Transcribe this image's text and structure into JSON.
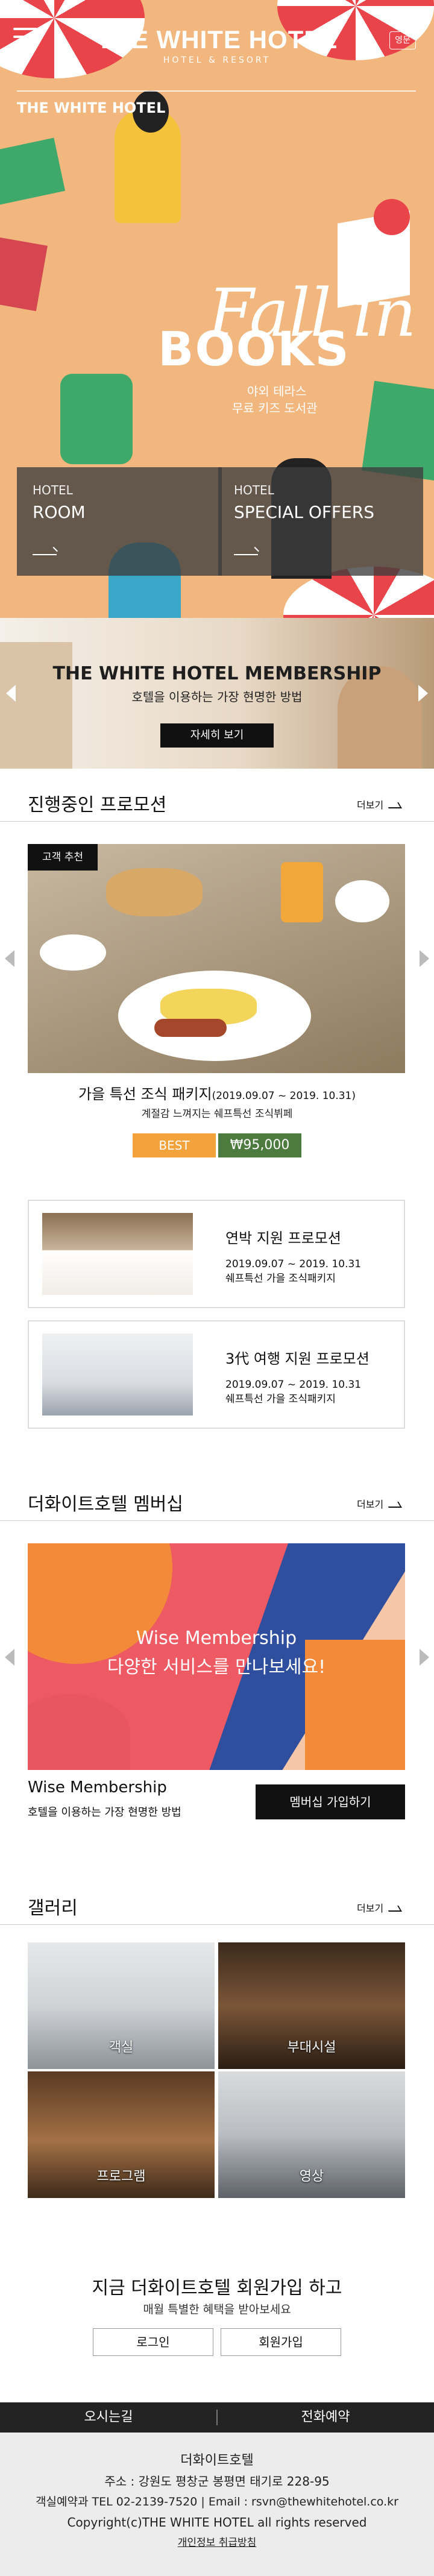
{
  "header": {
    "menu_icon": "hamburger-menu-icon",
    "logo_main": "THE WHITE HOTEL",
    "logo_sub": "HOTEL & RESORT",
    "lang_label": "영문"
  },
  "hero": {
    "tag": "THE WHITE HOTEL",
    "fall": "Fall in",
    "books": "BOOKS",
    "sub1": "야외 테라스",
    "sub2": "무료 키즈 도서관",
    "cards": [
      {
        "small": "HOTEL",
        "title": "ROOM"
      },
      {
        "small": "HOTEL",
        "title": "SPECIAL OFFERS"
      }
    ]
  },
  "membership_banner": {
    "title": "THE WHITE HOTEL MEMBERSHIP",
    "subtitle": "호텔을 이용하는 가장 현명한 방법",
    "button": "자세히 보기"
  },
  "promotions": {
    "title": "진행중인 프로모션",
    "more": "더보기",
    "badge": "고객 추천",
    "featured_name": "가을 특선 조식 패키지",
    "featured_period": "(2019.09.07 ~ 2019. 10.31)",
    "featured_desc": "계절감 느껴지는 쉐프특선 조식뷔페",
    "best_label": "BEST",
    "price": "₩95,000",
    "items": [
      {
        "title": "연박 지원 프로모션",
        "period": "2019.09.07 ~ 2019. 10.31",
        "desc": "쉐프특선 가을 조식패키지"
      },
      {
        "title": "3代 여행 지원 프로모션",
        "period": "2019.09.07 ~ 2019. 10.31",
        "desc": "쉐프특선 가을 조식패키지"
      }
    ]
  },
  "membership": {
    "title": "더화이트호텔 멤버십",
    "more": "더보기",
    "banner_line1": "Wise Membership",
    "banner_line2": "다양한 서비스를 만나보세요!",
    "name": "Wise Membership",
    "desc": "호텔을 이용하는 가장 현명한 방법",
    "join_button": "멤버십 가입하기"
  },
  "gallery": {
    "title": "갤러리",
    "more": "더보기",
    "items": [
      "객실",
      "부대시설",
      "프로그램",
      "영상"
    ]
  },
  "join": {
    "title": "지금 더화이트호텔 회원가입 하고",
    "subtitle": "매월 특별한 혜택을 받아보세요",
    "login": "로그인",
    "signup": "회원가입"
  },
  "footer": {
    "directions": "오시는길",
    "phone_reservation": "전화예약",
    "name": "더화이트호텔",
    "address": "주소 : 강원도 평창군 봉평면 태기로 228-95",
    "contact": "객실예약과 TEL 02-2139-7520 | Email : rsvn@thewhitehotel.co.kr",
    "copyright": "Copyright(c)THE WHITE HOTEL all rights reserved",
    "privacy": "개인정보 취급방침"
  }
}
